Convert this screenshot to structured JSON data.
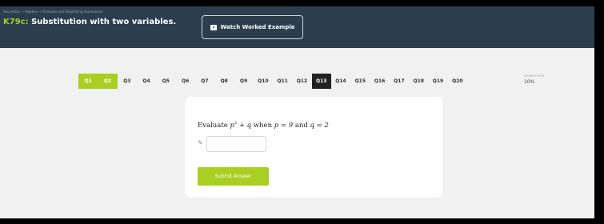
{
  "header": {
    "breadcrumb": "Secondary → Algebra → Formulae and Simplifying Expressions",
    "lesson_code": "K79c:",
    "lesson_title": " Substitution with two variables.",
    "watch_button_label": "Watch Worked Example",
    "watch_icon": "video-icon"
  },
  "nav": {
    "questions": [
      "Q1",
      "Q2",
      "Q3",
      "Q4",
      "Q5",
      "Q6",
      "Q7",
      "Q8",
      "Q9",
      "Q10",
      "Q11",
      "Q12",
      "Q13",
      "Q14",
      "Q15",
      "Q16",
      "Q17",
      "Q18",
      "Q19",
      "Q20"
    ],
    "completed": [
      "Q1",
      "Q2"
    ],
    "current": "Q13",
    "completion_label": "COMPLETION",
    "completion_value": "10%"
  },
  "question": {
    "prefix": "Evaluate ",
    "var_p": "p",
    "exponent": "2",
    "plus_q": " + q",
    "when": " when ",
    "p_eq": "p = 9",
    "and": " and ",
    "q_eq": "q = 2",
    "answer_value": "",
    "pencil_icon": "pencil-icon",
    "submit_label": "Submit Answer"
  },
  "colors": {
    "accent": "#a8cf22",
    "header_bg": "#2c3e4e",
    "current_bg": "#222222"
  }
}
